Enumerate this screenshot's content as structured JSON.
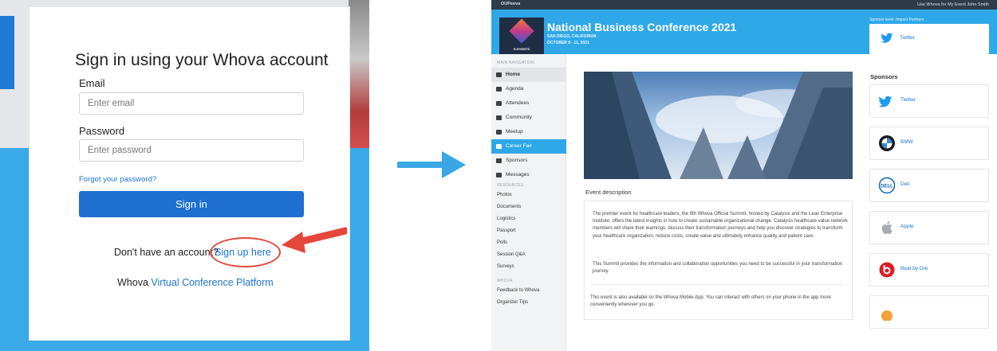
{
  "signin": {
    "title": "Sign in using your Whova account",
    "email_label": "Email",
    "email_placeholder": "Enter email",
    "password_label": "Password",
    "password_placeholder": "Enter password",
    "forgot_link": "Forgot your password?",
    "signin_button": "Sign in",
    "no_account_text": "Don't have an account?",
    "signup_link": "Sign up here",
    "platform_prefix": "Whova",
    "platform_link": "Virtual Conference Platform",
    "accent_color": "#1e6fd0",
    "highlight_color": "#e5473c"
  },
  "event": {
    "topbar_brand": "OUPeeva",
    "topbar_links": "Use Whova for My Event     John Smith",
    "title": "National Business Conference 2021",
    "location": "SAN DIEGO, CALIFORNIA",
    "dates": "OCTOBER 8 - 11, 2021",
    "logo_text": "E-EVENTS",
    "sponsor_level": "Sponsor level: Impact Partners",
    "header_sponsor": "Twitter",
    "nav_heading": "MAIN NAVIGATION",
    "nav": [
      {
        "label": "Home",
        "icon": "home-icon"
      },
      {
        "label": "Agenda",
        "icon": "calendar-icon"
      },
      {
        "label": "Attendees",
        "icon": "people-icon"
      },
      {
        "label": "Community",
        "icon": "chat-icon"
      },
      {
        "label": "Meetup",
        "icon": "group-icon"
      },
      {
        "label": "Career Fair",
        "icon": "briefcase-icon"
      },
      {
        "label": "Sponsors",
        "icon": "building-icon"
      },
      {
        "label": "Messages",
        "icon": "mail-icon"
      }
    ],
    "resources_heading": "RESOURCES",
    "resources": [
      "Photos",
      "Documents",
      "Logistics",
      "Passport",
      "Polls",
      "Session Q&A",
      "Surveys"
    ],
    "whova_heading": "WHOVA",
    "whova_items": [
      "Feedback to Whova",
      "Organizer Tips"
    ],
    "description_heading": "Event description",
    "description_p1": "The premier event for healthcare leaders, the 8th Whova Official Summit, hosted by Catalysis and the Lean Enterprise Institute, offers the latest insights in how to create sustainable organizational change. Catalysis healthcare value network members will share their learnings, discuss their transformation journeys and help you discover strategies to transform your healthcare organization, reduce costs, create value and ultimately enhance quality and patient care.",
    "description_p2": "This Summit provides the information and collaboration opportunities you need to be successful in your transformation journey.",
    "description_p3": "This event is also available on the Whova Mobile App. You can interact with others on your phone in the app more conveniently wherever you go.",
    "sponsors_heading": "Sponsors",
    "sponsors": [
      {
        "name": "Twitter",
        "icon": "twitter-icon"
      },
      {
        "name": "BMW",
        "icon": "bmw-icon"
      },
      {
        "name": "Dell",
        "icon": "dell-icon"
      },
      {
        "name": "Apple",
        "icon": "apple-icon"
      },
      {
        "name": "Beat by Dre",
        "icon": "beats-icon"
      }
    ],
    "brand_color": "#2fa8e8"
  }
}
